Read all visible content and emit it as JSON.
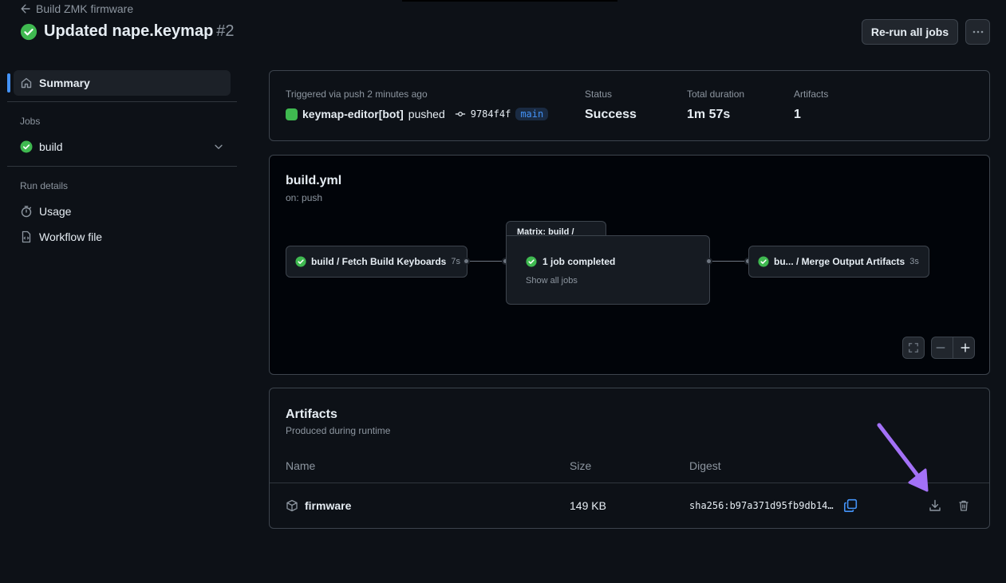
{
  "header": {
    "back_label": "Build ZMK firmware",
    "title": "Updated nape.keymap",
    "run_number": "#2",
    "rerun_label": "Re-run all jobs"
  },
  "sidebar": {
    "summary_label": "Summary",
    "jobs_heading": "Jobs",
    "job_label": "build",
    "run_details_heading": "Run details",
    "usage_label": "Usage",
    "workflow_file_label": "Workflow file"
  },
  "summary": {
    "triggered": "Triggered via push 2 minutes ago",
    "actor": "keymap-editor[bot]",
    "action": "pushed",
    "commit": "9784f4f",
    "branch": "main",
    "status_label": "Status",
    "status_value": "Success",
    "duration_label": "Total duration",
    "duration_value": "1m 57s",
    "artifacts_label": "Artifacts",
    "artifacts_value": "1"
  },
  "graph": {
    "file": "build.yml",
    "trigger": "on: push",
    "node1_label": "build / Fetch Build Keyboards",
    "node1_duration": "7s",
    "matrix_label": "Matrix: build / Build",
    "matrix_status": "1 job completed",
    "matrix_link": "Show all jobs",
    "node3_label": "bu... / Merge Output Artifacts",
    "node3_duration": "3s"
  },
  "artifacts": {
    "title": "Artifacts",
    "subtitle": "Produced during runtime",
    "columns": [
      "Name",
      "Size",
      "Digest"
    ],
    "rows": [
      {
        "name": "firmware",
        "size": "149 KB",
        "digest": "sha256:b97a371d95fb9db14…"
      }
    ]
  },
  "colors": {
    "success": "#3fb950",
    "accent": "#4493f8",
    "annotation_arrow": "#a371f7"
  }
}
